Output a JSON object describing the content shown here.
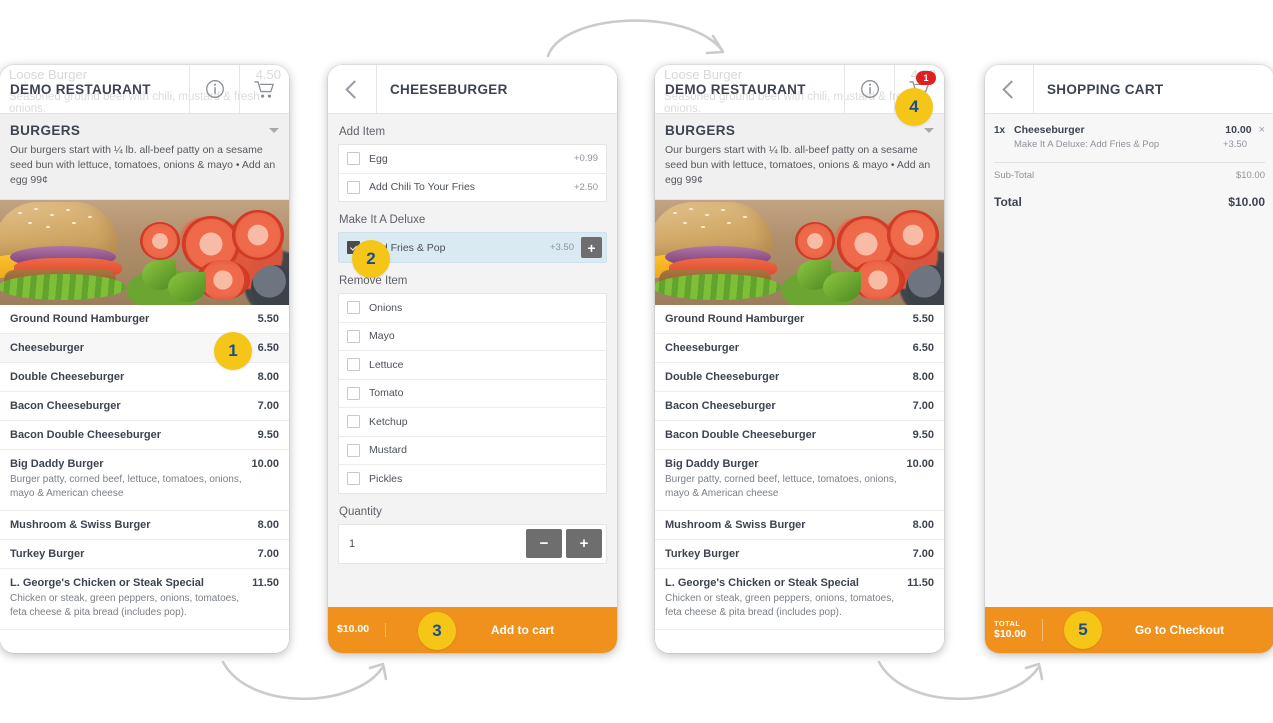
{
  "colors": {
    "orange": "#f0911e",
    "badge_yellow": "#f5c518",
    "badge_number": "#1b4f8a",
    "cart_badge_red": "#e02020",
    "deluxe_highlight": "#daeaf2",
    "text_dark": "#3d4450",
    "text_muted": "#8e939a",
    "arrow_gray": "#c9cbcd"
  },
  "ghost": {
    "title": "Loose Burger",
    "desc": "Seasoned ground beef with chili, mustard & fresh onions.",
    "price": "4.50"
  },
  "menu_panel": {
    "header": {
      "title": "DEMO RESTAURANT",
      "info_icon": "info-circle-icon",
      "cart_icon": "shopping-cart-icon"
    },
    "section": {
      "name": "BURGERS",
      "description": "Our burgers start with ¼ lb. all-beef patty on a sesame seed bun with lettuce, tomatoes, onions & mayo • Add an egg 99¢",
      "collapse_icon": "caret-down-icon"
    },
    "items": [
      {
        "name": "Ground Round Hamburger",
        "price": "5.50",
        "desc": ""
      },
      {
        "name": "Cheeseburger",
        "price": "6.50",
        "desc": ""
      },
      {
        "name": "Double Cheeseburger",
        "price": "8.00",
        "desc": ""
      },
      {
        "name": "Bacon Cheeseburger",
        "price": "7.00",
        "desc": ""
      },
      {
        "name": "Bacon Double Cheeseburger",
        "price": "9.50",
        "desc": ""
      },
      {
        "name": "Big Daddy Burger",
        "price": "10.00",
        "desc": "Burger patty, corned beef, lettuce, tomatoes, onions, mayo & American cheese"
      },
      {
        "name": "Mushroom & Swiss Burger",
        "price": "8.00",
        "desc": ""
      },
      {
        "name": "Turkey Burger",
        "price": "7.00",
        "desc": ""
      },
      {
        "name": "L. George's Chicken or Steak Special",
        "price": "11.50",
        "desc": "Chicken or steak, green peppers, onions, tomatoes, feta cheese & pita bread (includes pop)."
      }
    ]
  },
  "menu_panel_with_cart": {
    "cart_count": "1"
  },
  "detail_panel": {
    "header": {
      "back_icon": "chevron-left-icon",
      "title": "CHEESEBURGER"
    },
    "groups": [
      {
        "label": "Add Item",
        "options": [
          {
            "label": "Egg",
            "price": "+0.99",
            "checked": false
          },
          {
            "label": "Add Chili To Your Fries",
            "price": "+2.50",
            "checked": false
          }
        ]
      },
      {
        "label": "Make It A Deluxe",
        "options": [
          {
            "label": "Add Fries & Pop",
            "price": "+3.50",
            "checked": true,
            "add_icon": "plus-icon"
          }
        ]
      },
      {
        "label": "Remove Item",
        "options": [
          {
            "label": "Onions",
            "price": "",
            "checked": false
          },
          {
            "label": "Mayo",
            "price": "",
            "checked": false
          },
          {
            "label": "Lettuce",
            "price": "",
            "checked": false
          },
          {
            "label": "Tomato",
            "price": "",
            "checked": false
          },
          {
            "label": "Ketchup",
            "price": "",
            "checked": false
          },
          {
            "label": "Mustard",
            "price": "",
            "checked": false
          },
          {
            "label": "Pickles",
            "price": "",
            "checked": false
          }
        ]
      }
    ],
    "quantity": {
      "label": "Quantity",
      "value": "1",
      "minus_icon": "minus-icon",
      "plus_icon": "plus-icon"
    },
    "footer": {
      "total": "$10.00",
      "cta": "Add to cart"
    }
  },
  "cart_panel": {
    "header": {
      "back_icon": "chevron-left-icon",
      "title": "SHOPPING CART"
    },
    "items": [
      {
        "qty": "1x",
        "name": "Cheeseburger",
        "price": "10.00",
        "remove_icon": "close-icon",
        "option_label": "Make It A Deluxe: Add Fries & Pop",
        "option_price": "+3.50"
      }
    ],
    "subtotal_label": "Sub-Total",
    "subtotal_value": "$10.00",
    "total_label": "Total",
    "total_value": "$10.00",
    "footer": {
      "total_label": "TOTAL",
      "total_value": "$10.00",
      "cta": "Go to Checkout"
    }
  },
  "steps": [
    {
      "number": "1"
    },
    {
      "number": "2"
    },
    {
      "number": "3"
    },
    {
      "number": "4"
    },
    {
      "number": "5"
    }
  ]
}
